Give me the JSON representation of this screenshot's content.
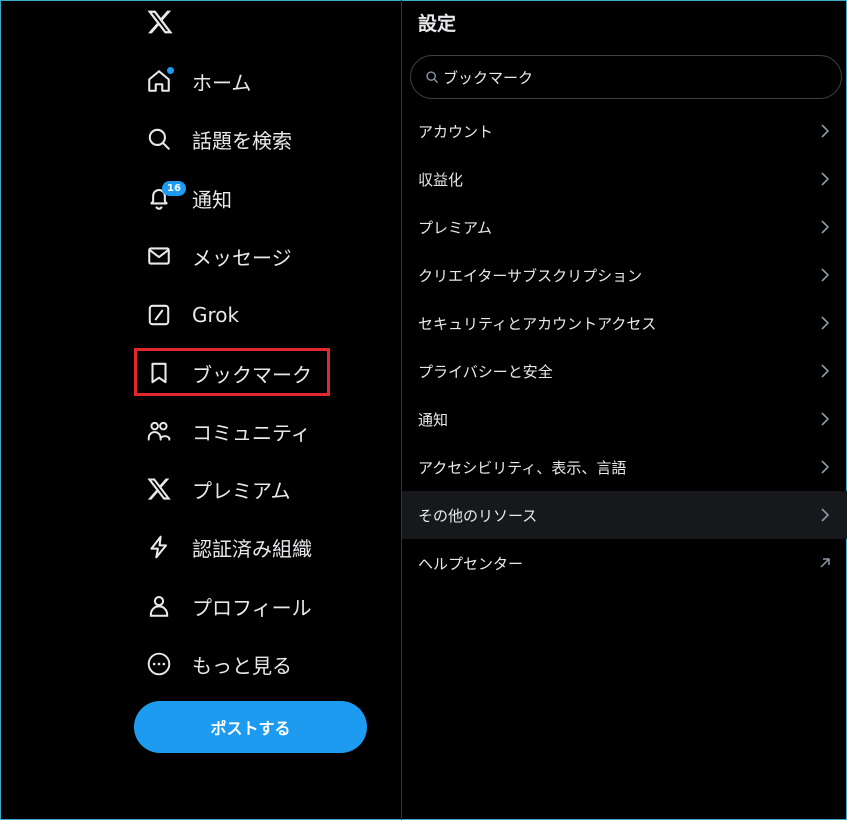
{
  "nav": {
    "items": [
      {
        "label": "ホーム",
        "icon": "home-icon"
      },
      {
        "label": "話題を検索",
        "icon": "search-icon"
      },
      {
        "label": "通知",
        "icon": "bell-icon",
        "badge": "16"
      },
      {
        "label": "メッセージ",
        "icon": "mail-icon"
      },
      {
        "label": "Grok",
        "icon": "grok-icon"
      },
      {
        "label": "ブックマーク",
        "icon": "bookmark-icon"
      },
      {
        "label": "コミュニティ",
        "icon": "communities-icon"
      },
      {
        "label": "プレミアム",
        "icon": "x-premium-icon"
      },
      {
        "label": "認証済み組織",
        "icon": "lightning-icon"
      },
      {
        "label": "プロフィール",
        "icon": "profile-icon"
      },
      {
        "label": "もっと見る",
        "icon": "more-icon"
      }
    ],
    "post_button": "ポストする"
  },
  "settings": {
    "title": "設定",
    "search_value": "ブックマーク",
    "items": [
      {
        "label": "アカウント",
        "arrow": "chevron-right"
      },
      {
        "label": "収益化",
        "arrow": "chevron-right"
      },
      {
        "label": "プレミアム",
        "arrow": "chevron-right"
      },
      {
        "label": "クリエイターサブスクリプション",
        "arrow": "chevron-right"
      },
      {
        "label": "セキュリティとアカウントアクセス",
        "arrow": "chevron-right"
      },
      {
        "label": "プライバシーと安全",
        "arrow": "chevron-right"
      },
      {
        "label": "通知",
        "arrow": "chevron-right"
      },
      {
        "label": "アクセシビリティ、表示、言語",
        "arrow": "chevron-right"
      },
      {
        "label": "その他のリソース",
        "arrow": "chevron-right"
      },
      {
        "label": "ヘルプセンター",
        "arrow": "external-link"
      }
    ]
  },
  "colors": {
    "accent": "#1d9bf0",
    "highlight": "#e0282e",
    "background": "#000000",
    "text": "#e7e9ea",
    "active_row": "#16181c"
  }
}
